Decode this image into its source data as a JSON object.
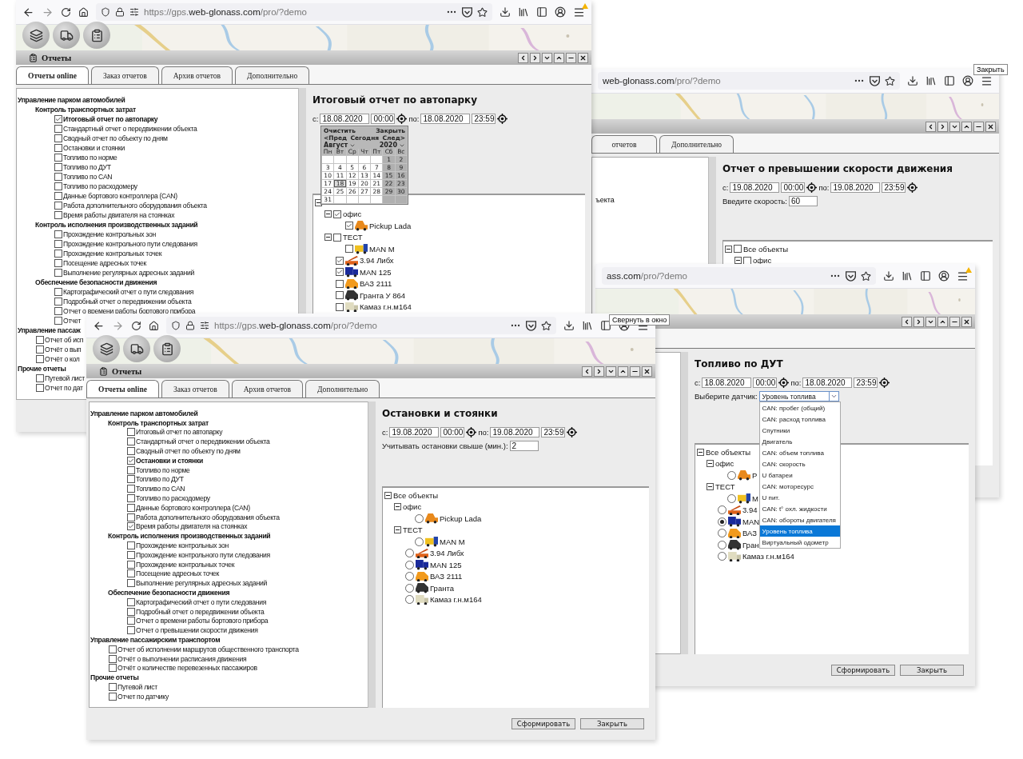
{
  "windows": [
    {
      "browser": {
        "nav": true,
        "alert": true,
        "map_buttons": true,
        "url": {
          "prefix": "https://gps.",
          "domain": "web-glonass.com",
          "path": "/pro/?demo"
        }
      },
      "dialog": {
        "title": "Отчеты",
        "tabs": [
          {
            "label": "Отчеты online",
            "selected": true
          },
          {
            "label": "Заказ отчетов",
            "selected": false
          },
          {
            "label": "Архив отчетов",
            "selected": false
          },
          {
            "label": "Дополнительно",
            "selected": false
          }
        ],
        "reports": [
          {
            "title": "Управление парком автомобилей",
            "children": [
              {
                "title": "Контроль транспортных затрат",
                "children": [
                  {
                    "label": "Итоговый отчет по автопарку",
                    "checked": true,
                    "selected": true
                  },
                  {
                    "label": "Стандартный отчет о передвижении объекта",
                    "checked": false,
                    "selected": false
                  },
                  {
                    "label": "Сводный отчет по объекту по дням",
                    "checked": false,
                    "selected": false
                  },
                  {
                    "label": "Остановки и стоянки",
                    "checked": false,
                    "selected": false
                  },
                  {
                    "label": "Топливо по норме",
                    "checked": false,
                    "selected": false
                  },
                  {
                    "label": "Топливо по ДУТ",
                    "checked": false,
                    "selected": false
                  },
                  {
                    "label": "Топливо по CAN",
                    "checked": false,
                    "selected": false
                  },
                  {
                    "label": "Топливо по расходомеру",
                    "checked": false,
                    "selected": false
                  },
                  {
                    "label": "Данные бортового контроллера (CAN)",
                    "checked": false,
                    "selected": false
                  },
                  {
                    "label": "Работа дополнительного оборудования объекта",
                    "checked": false,
                    "selected": false
                  },
                  {
                    "label": "Время работы двигателя на стоянках",
                    "checked": false,
                    "selected": false
                  }
                ]
              },
              {
                "title": "Контроль исполнения производственных заданий",
                "children": [
                  {
                    "label": "Прохождение контрольных зон",
                    "checked": false,
                    "selected": false
                  },
                  {
                    "label": "Прохождение контрольного пути следования",
                    "checked": false,
                    "selected": false
                  },
                  {
                    "label": "Прохождение контрольных точек",
                    "checked": false,
                    "selected": false
                  },
                  {
                    "label": "Посещение адресных точек",
                    "checked": false,
                    "selected": false
                  },
                  {
                    "label": "Выполнение регулярных адресных заданий",
                    "checked": false,
                    "selected": false
                  }
                ]
              },
              {
                "title": "Обеспечение безопасности движения",
                "children": [
                  {
                    "label": "Картографический отчет о пути следования",
                    "checked": false,
                    "selected": false
                  },
                  {
                    "label": "Подробный отчет о передвижении объекта",
                    "checked": false,
                    "selected": false
                  },
                  {
                    "label": "Отчет о времени работы бортового прибора",
                    "checked": false,
                    "selected": false
                  },
                  {
                    "label": "Отчет",
                    "checked": false,
                    "selected": false
                  }
                ]
              }
            ]
          },
          {
            "title": "Управление пассаж",
            "children": [
              {
                "label": "Отчет об исп",
                "checked": false,
                "selected": false
              },
              {
                "label": "Отчёт о вып",
                "checked": false,
                "selected": false
              },
              {
                "label": "Отчёт о кол",
                "checked": false,
                "selected": false
              }
            ]
          },
          {
            "title": "Прочие отчеты",
            "children": [
              {
                "label": "Путевой лист",
                "checked": false,
                "selected": false
              },
              {
                "label": "Отчет по дат",
                "checked": false,
                "selected": false
              }
            ]
          }
        ],
        "panel": {
          "title": "Итоговый отчет по автопарку",
          "period": {
            "from_label": "с:",
            "from_date": "18.08.2020",
            "from_time": "00:00",
            "to_label": "по:",
            "to_date": "18.08.2020",
            "to_time": "23:59"
          },
          "calendar": {
            "clear": "Очистить",
            "close": "Закрыть",
            "prev": "<Пред",
            "today": "Сегодня",
            "next": "След>",
            "month": "Август",
            "year": "2020",
            "weekdays": [
              "Пн",
              "Вт",
              "Ср",
              "Чт",
              "Пт",
              "Сб",
              "Вс"
            ],
            "weeks": [
              [
                {
                  "label": "1",
                  "selected": false
                },
                {
                  "label": "2",
                  "selected": false
                }
              ],
              [
                {
                  "label": "3",
                  "selected": false
                },
                {
                  "label": "4",
                  "selected": false
                },
                {
                  "label": "5",
                  "selected": false
                },
                {
                  "label": "6",
                  "selected": false
                },
                {
                  "label": "7",
                  "selected": false
                },
                {
                  "label": "8",
                  "selected": false
                },
                {
                  "label": "9",
                  "selected": false
                }
              ],
              [
                {
                  "label": "10",
                  "selected": false
                },
                {
                  "label": "11",
                  "selected": false
                },
                {
                  "label": "12",
                  "selected": false
                },
                {
                  "label": "13",
                  "selected": false
                },
                {
                  "label": "14",
                  "selected": false
                },
                {
                  "label": "15",
                  "selected": false
                },
                {
                  "label": "16",
                  "selected": false
                }
              ],
              [
                {
                  "label": "17",
                  "selected": false
                },
                {
                  "label": "18",
                  "selected": true
                },
                {
                  "label": "19",
                  "selected": false
                },
                {
                  "label": "20",
                  "selected": false
                },
                {
                  "label": "21",
                  "selected": false
                },
                {
                  "label": "22",
                  "selected": false
                },
                {
                  "label": "23",
                  "selected": false
                }
              ],
              [
                {
                  "label": "24",
                  "selected": false
                },
                {
                  "label": "25",
                  "selected": false
                },
                {
                  "label": "26",
                  "selected": false
                },
                {
                  "label": "27",
                  "selected": false
                },
                {
                  "label": "28",
                  "selected": false
                },
                {
                  "label": "29",
                  "selected": false
                },
                {
                  "label": "30",
                  "selected": false
                }
              ],
              [
                {
                  "label": "31",
                  "selected": false
                }
              ]
            ]
          },
          "tree": {
            "nodes": [
              {
                "children": [
                  {
                    "label": "офис",
                    "checked": true,
                    "children": [
                      {
                        "label": "Pickup Lada",
                        "checked": true,
                        "kind": "pickup"
                      }
                    ]
                  },
                  {
                    "label": "ТЕСТ",
                    "checked": false,
                    "children": [
                      {
                        "label": "MAN M",
                        "checked": false,
                        "kind": "bus"
                      }
                    ]
                  },
                  {
                    "label": "3.94 Либх",
                    "checked": true,
                    "kind": "crane"
                  },
                  {
                    "label": "MAN 125",
                    "checked": true,
                    "kind": "box-truck"
                  },
                  {
                    "label": "ВАЗ 2111",
                    "checked": false,
                    "kind": "car"
                  },
                  {
                    "label": "Гранта У 864",
                    "checked": false,
                    "kind": "dark-car"
                  },
                  {
                    "label": "Камаз г.н.м164",
                    "checked": false,
                    "kind": "van"
                  }
                ]
              }
            ]
          }
        }
      }
    },
    {
      "browser": {
        "url": {
          "domain": "web-glonass.com",
          "path": "/pro/?demo"
        }
      },
      "dialog": {
        "tabs": [
          {
            "label": "отчетов",
            "selected": false
          },
          {
            "label": "Дополнительно",
            "selected": false
          }
        ],
        "list_fragment": "ъекта",
        "panel": {
          "title": "Отчет о превышении скорости движения",
          "period": {
            "from_label": "с:",
            "from_date": "19.08.2020",
            "from_time": "00:00",
            "to_label": "по:",
            "to_date": "19.08.2020",
            "to_time": "23:59"
          },
          "field": {
            "label": "Введите скорость:",
            "value": "60"
          },
          "tree": {
            "nodes": [
              {
                "label": "Все объекты",
                "checked": false,
                "children": [
                  {
                    "label": "офис",
                    "checked": false,
                    "expanded": true
                  }
                ]
              }
            ]
          }
        }
      }
    },
    {
      "browser": {
        "alert": true,
        "url": {
          "domain": "ass.com",
          "path": "/pro/?demo"
        }
      },
      "dialog": {
        "panel": {
          "title": "Топливо по ДУТ",
          "period": {
            "from_label": "с:",
            "from_date": "18.08.2020",
            "from_time": "00:00",
            "to_label": "по:",
            "to_date": "18.08.2020",
            "to_time": "23:59"
          },
          "select": {
            "label": "Выберите датчик:",
            "value": "Уровень топлива",
            "options": [
              {
                "label": "CAN: пробег (общий)",
                "selected": false
              },
              {
                "label": "CAN: расход топлива",
                "selected": false
              },
              {
                "label": "Спутники",
                "selected": false
              },
              {
                "label": "Двигатель",
                "selected": false
              },
              {
                "label": "CAN: объем топлива",
                "selected": false
              },
              {
                "label": "CAN: скорость",
                "selected": false
              },
              {
                "label": "U батареи",
                "selected": false
              },
              {
                "label": "CAN: моторесурс",
                "selected": false
              },
              {
                "label": "U пит.",
                "selected": false
              },
              {
                "label": "CAN: t° охл. жидкости",
                "selected": false
              },
              {
                "label": "CAN: обороты двигателя",
                "selected": false
              },
              {
                "label": "Уровень топлива",
                "selected": true
              },
              {
                "label": "Виртуальный одометр",
                "selected": false
              }
            ]
          },
          "tree": {
            "nodes": [
              {
                "label": "Все объекты",
                "children": [
                  {
                    "label": "офис",
                    "children": [
                      {
                        "label": "P",
                        "selected": false,
                        "kind": "pickup"
                      }
                    ]
                  },
                  {
                    "label": "ТЕСТ",
                    "children": [
                      {
                        "label": "M",
                        "selected": false,
                        "kind": "bus"
                      }
                    ]
                  },
                  {
                    "label": "3.94",
                    "selected": false,
                    "kind": "crane"
                  },
                  {
                    "label": "MAN",
                    "selected": true,
                    "kind": "box-truck"
                  },
                  {
                    "label": "ВАЗ",
                    "selected": false,
                    "kind": "car"
                  },
                  {
                    "label": "Гран",
                    "selected": false,
                    "kind": "dark-car"
                  },
                  {
                    "label": "Камаз г.н.м164",
                    "selected": false,
                    "kind": "van"
                  }
                ]
              }
            ]
          }
        },
        "buttons": [
          "Сформировать",
          "Закрыть"
        ]
      }
    },
    {
      "browser": {
        "nav": true,
        "map_buttons": true,
        "url": {
          "prefix": "https://gps.",
          "domain": "web-glonass.com",
          "path": "/pro/?demo"
        }
      },
      "dialog": {
        "title": "Отчеты",
        "tabs": [
          {
            "label": "Отчеты online",
            "selected": true
          },
          {
            "label": "Заказ отчетов",
            "selected": false
          },
          {
            "label": "Архив отчетов",
            "selected": false
          },
          {
            "label": "Дополнительно",
            "selected": false
          }
        ],
        "reports": [
          {
            "title": "Управление парком автомобилей",
            "children": [
              {
                "title": "Контроль транспортных затрат",
                "children": [
                  {
                    "label": "Итоговый отчет по автопарку",
                    "checked": false,
                    "selected": false
                  },
                  {
                    "label": "Стандартный отчет о передвижении объекта",
                    "checked": false,
                    "selected": false
                  },
                  {
                    "label": "Сводный отчет по объекту по дням",
                    "checked": false,
                    "selected": false
                  },
                  {
                    "label": "Остановки и стоянки",
                    "checked": true,
                    "selected": true
                  },
                  {
                    "label": "Топливо по норме",
                    "checked": false,
                    "selected": false
                  },
                  {
                    "label": "Топливо по ДУТ",
                    "checked": false,
                    "selected": false
                  },
                  {
                    "label": "Топливо по CAN",
                    "checked": false,
                    "selected": false
                  },
                  {
                    "label": "Топливо по расходомеру",
                    "checked": false,
                    "selected": false
                  },
                  {
                    "label": "Данные бортового контроллера (CAN)",
                    "checked": false,
                    "selected": false
                  },
                  {
                    "label": "Работа дополнительного оборудования объекта",
                    "checked": false,
                    "selected": false
                  },
                  {
                    "label": "Время работы двигателя на стоянках",
                    "checked": true,
                    "selected": false
                  }
                ]
              },
              {
                "title": "Контроль исполнения производственных заданий",
                "children": [
                  {
                    "label": "Прохождение контрольных зон",
                    "checked": false,
                    "selected": false
                  },
                  {
                    "label": "Прохождение контрольного пути следования",
                    "checked": false,
                    "selected": false
                  },
                  {
                    "label": "Прохождение контрольных точек",
                    "checked": false,
                    "selected": false
                  },
                  {
                    "label": "Посещение адресных точек",
                    "checked": false,
                    "selected": false
                  },
                  {
                    "label": "Выполнение регулярных адресных заданий",
                    "checked": false,
                    "selected": false
                  }
                ]
              },
              {
                "title": "Обеспечение безопасности движения",
                "children": [
                  {
                    "label": "Картографический отчет о пути следования",
                    "checked": false,
                    "selected": false
                  },
                  {
                    "label": "Подробный отчет о передвижении объекта",
                    "checked": false,
                    "selected": false
                  },
                  {
                    "label": "Отчет о времени работы бортового прибора",
                    "checked": false,
                    "selected": false
                  },
                  {
                    "label": "Отчет о превышении скорости движения",
                    "checked": false,
                    "selected": false
                  }
                ]
              }
            ]
          },
          {
            "title": "Управление пассажирским транспортом",
            "children": [
              {
                "label": "Отчет об исполнении маршрутов общественного транспорта",
                "checked": false,
                "selected": false
              },
              {
                "label": "Отчёт о выполнении расписания движения",
                "checked": false,
                "selected": false
              },
              {
                "label": "Отчёт о количестве перевезенных пассажиров",
                "checked": false,
                "selected": false
              }
            ]
          },
          {
            "title": "Прочие отчеты",
            "children": [
              {
                "label": "Путевой лист",
                "checked": false,
                "selected": false
              },
              {
                "label": "Отчет по датчику",
                "checked": false,
                "selected": false
              }
            ]
          }
        ],
        "panel": {
          "title": "Остановки и стоянки",
          "period": {
            "from_label": "с:",
            "from_date": "19.08.2020",
            "from_time": "00:00",
            "to_label": "по:",
            "to_date": "19.08.2020",
            "to_time": "23:59"
          },
          "field": {
            "label": "Учитывать остановки свыше (мин.):",
            "value": "2"
          },
          "tree": {
            "nodes": [
              {
                "label": "Все объекты",
                "children": [
                  {
                    "label": "офис",
                    "children": [
                      {
                        "label": "Pickup Lada",
                        "selected": false,
                        "kind": "pickup"
                      }
                    ]
                  },
                  {
                    "label": "ТЕСТ",
                    "children": [
                      {
                        "label": "MAN M",
                        "selected": false,
                        "kind": "bus"
                      }
                    ]
                  },
                  {
                    "label": "3.94 Либх",
                    "selected": false,
                    "kind": "crane"
                  },
                  {
                    "label": "MAN 125",
                    "selected": false,
                    "kind": "box-truck"
                  },
                  {
                    "label": "ВАЗ 2111",
                    "selected": false,
                    "kind": "car"
                  },
                  {
                    "label": "Гранта",
                    "selected": false,
                    "kind": "dark-car"
                  },
                  {
                    "label": "Камаз г.н.м164",
                    "selected": false,
                    "kind": "van"
                  }
                ]
              }
            ]
          }
        },
        "buttons": [
          "Сформировать",
          "Закрыть"
        ]
      }
    }
  ],
  "tooltips": [
    {
      "text": "Закрыть"
    },
    {
      "text": "Свернуть в окно"
    }
  ]
}
